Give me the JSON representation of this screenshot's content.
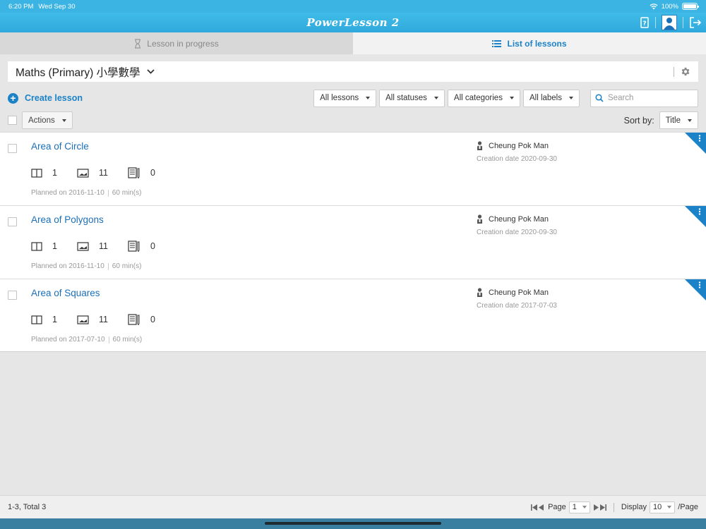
{
  "status": {
    "time": "6:20 PM",
    "date": "Wed Sep 30",
    "battery": "100%",
    "battery_level": 1.0
  },
  "app": {
    "title": "PowerLesson 2"
  },
  "tabs": [
    {
      "label": "Lesson in progress",
      "icon": "hourglass-icon",
      "active": false
    },
    {
      "label": "List of lessons",
      "icon": "list-icon",
      "active": true
    }
  ],
  "subject": {
    "title": "Maths (Primary) 小學數學"
  },
  "toolbar": {
    "create_label": "Create lesson",
    "filters": [
      "All lessons",
      "All statuses",
      "All categories",
      "All labels"
    ],
    "search_placeholder": "Search"
  },
  "actions": {
    "label": "Actions"
  },
  "sort": {
    "label": "Sort by:",
    "value": "Title"
  },
  "lessons": [
    {
      "title": "Area of Circle",
      "stats": [
        "1",
        "11",
        "0"
      ],
      "planned": "Planned on 2016-11-10",
      "duration": "60 min(s)",
      "author": "Cheung Pok Man",
      "created": "Creation date 2020-09-30"
    },
    {
      "title": "Area of Polygons",
      "stats": [
        "1",
        "11",
        "0"
      ],
      "planned": "Planned on 2016-11-10",
      "duration": "60 min(s)",
      "author": "Cheung Pok Man",
      "created": "Creation date 2020-09-30"
    },
    {
      "title": "Area of Squares",
      "stats": [
        "1",
        "11",
        "0"
      ],
      "planned": "Planned on 2017-07-10",
      "duration": "60 min(s)",
      "author": "Cheung Pok Man",
      "created": "Creation date 2017-07-03"
    }
  ],
  "footer": {
    "summary": "1-3, Total 3",
    "page_label": "Page",
    "page_value": "1",
    "display_label": "Display",
    "display_value": "10",
    "per_page": "/Page"
  },
  "colors": {
    "brand": "#3bb3e3",
    "link": "#1b6fb8",
    "accent": "#1b82c8"
  }
}
